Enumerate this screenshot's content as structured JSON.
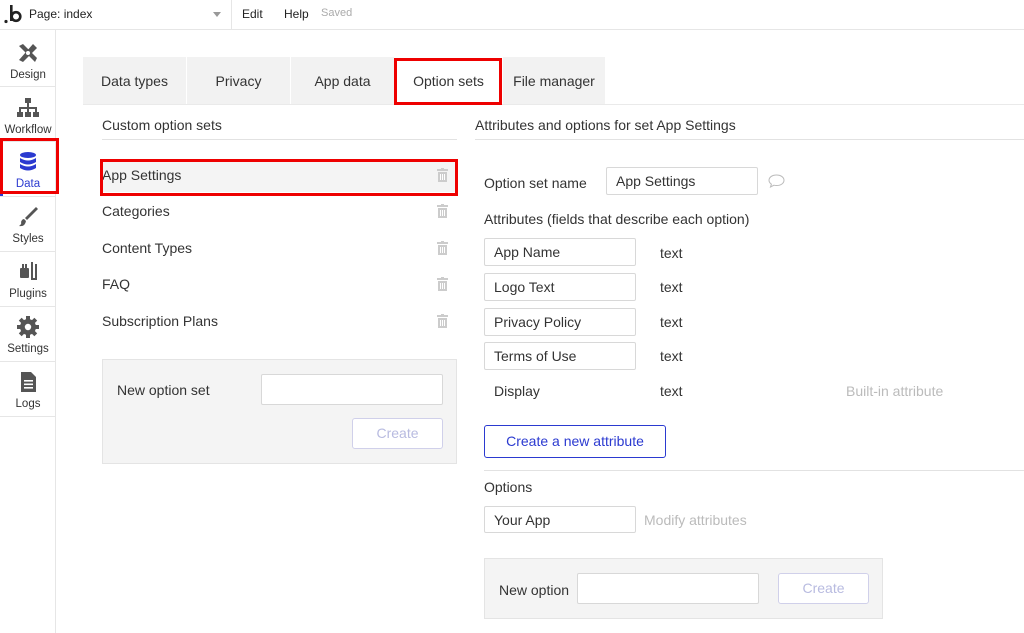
{
  "topbar": {
    "page_label": "Page: index",
    "edit": "Edit",
    "help": "Help",
    "saved": "Saved"
  },
  "sidebar": {
    "items": [
      {
        "label": "Design",
        "icon": "design-icon"
      },
      {
        "label": "Workflow",
        "icon": "workflow-icon"
      },
      {
        "label": "Data",
        "icon": "database-icon"
      },
      {
        "label": "Styles",
        "icon": "brush-icon"
      },
      {
        "label": "Plugins",
        "icon": "plug-icon"
      },
      {
        "label": "Settings",
        "icon": "gear-icon"
      },
      {
        "label": "Logs",
        "icon": "document-icon"
      }
    ]
  },
  "tabs": [
    "Data types",
    "Privacy",
    "App data",
    "Option sets",
    "File manager"
  ],
  "left": {
    "title": "Custom option sets",
    "sets": [
      "App Settings",
      "Categories",
      "Content Types",
      "FAQ",
      "Subscription Plans"
    ],
    "new_label": "New option set",
    "new_value": "",
    "create": "Create"
  },
  "right": {
    "title": "Attributes and options for set App Settings",
    "name_label": "Option set name",
    "name_value": "App Settings",
    "attr_heading": "Attributes (fields that describe each option)",
    "attributes": [
      {
        "name": "App Name",
        "type": "text"
      },
      {
        "name": "Logo Text",
        "type": "text"
      },
      {
        "name": "Privacy Policy",
        "type": "text"
      },
      {
        "name": "Terms of Use",
        "type": "text"
      },
      {
        "name": "Display",
        "type": "text",
        "note": "Built-in attribute"
      }
    ],
    "create_attr": "Create a new attribute",
    "options_heading": "Options",
    "option_value": "Your App",
    "modify": "Modify attributes",
    "new_option_label": "New option",
    "new_option_value": "",
    "create": "Create"
  },
  "colors": {
    "accent": "#2b3ad0",
    "highlight": "#e00000"
  }
}
